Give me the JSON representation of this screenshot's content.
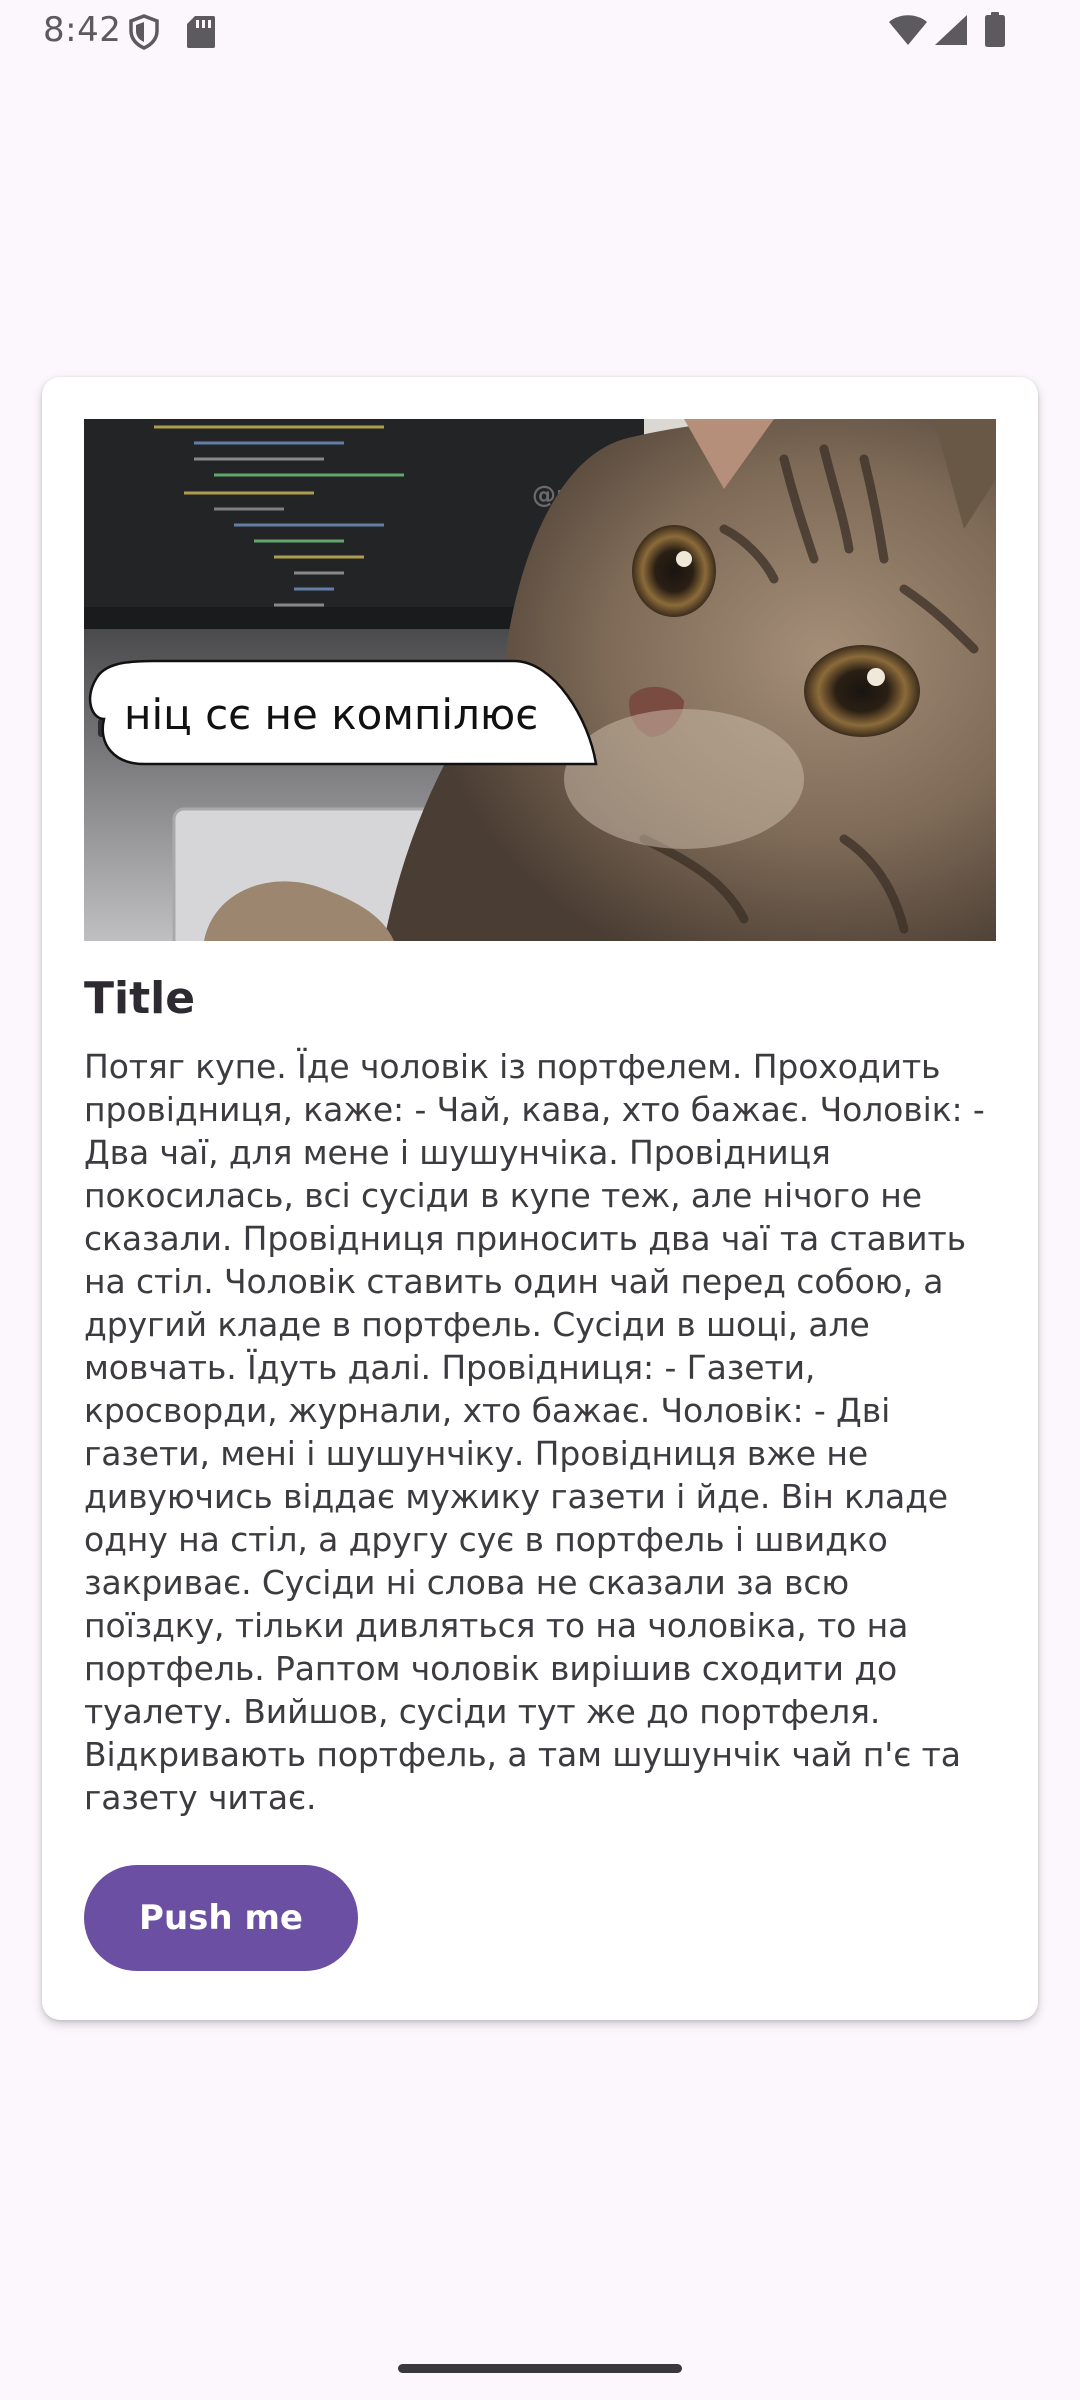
{
  "status_bar": {
    "time": "8:42",
    "icons": [
      "shield-icon",
      "sd-card-icon",
      "wifi-icon",
      "cell-signal-icon",
      "battery-icon"
    ]
  },
  "card": {
    "image": {
      "caption": "ніц сє не компілює",
      "watermark": "@moja",
      "description": "kitten"
    },
    "title": "Title",
    "body": "Потяг купе. Їде чоловік із портфелем. Проходить провідниця, каже: - Чай, кава, хто бажає. Чоловік: - Два чаї, для мене і шушунчіка. Провідниця покосилась, всі сусіди в купе теж, але нічого не сказали. Провідниця приносить два чаї та ставить на стіл. Чоловік ставить один чай перед собою, а другий кладе в портфель. Сусіди в шоці, але мовчать. Їдуть далі. Провідниця: - Газети, кросворди, журнали, хто бажає. Чоловік: - Дві газети, мені і шушунчіку. Провідниця вже не дивуючись віддає мужику газети і йде. Він кладе одну на стіл, а другу сує в портфель і швидко закриває. Сусіди ні слова не сказали за всю поїздку, тільки дивляться то на чоловіка, то на портфель. Раптом чоловік вирішив сходити до туалету. Вийшов, сусіди тут же до портфеля. Відкривають портфель, а там шушунчік чай п'є та газету читає.",
    "button_label": "Push me"
  },
  "colors": {
    "background": "#fcf7fc",
    "button": "#6b4fa2",
    "title": "#2d2b31",
    "body": "#3d3b40"
  }
}
